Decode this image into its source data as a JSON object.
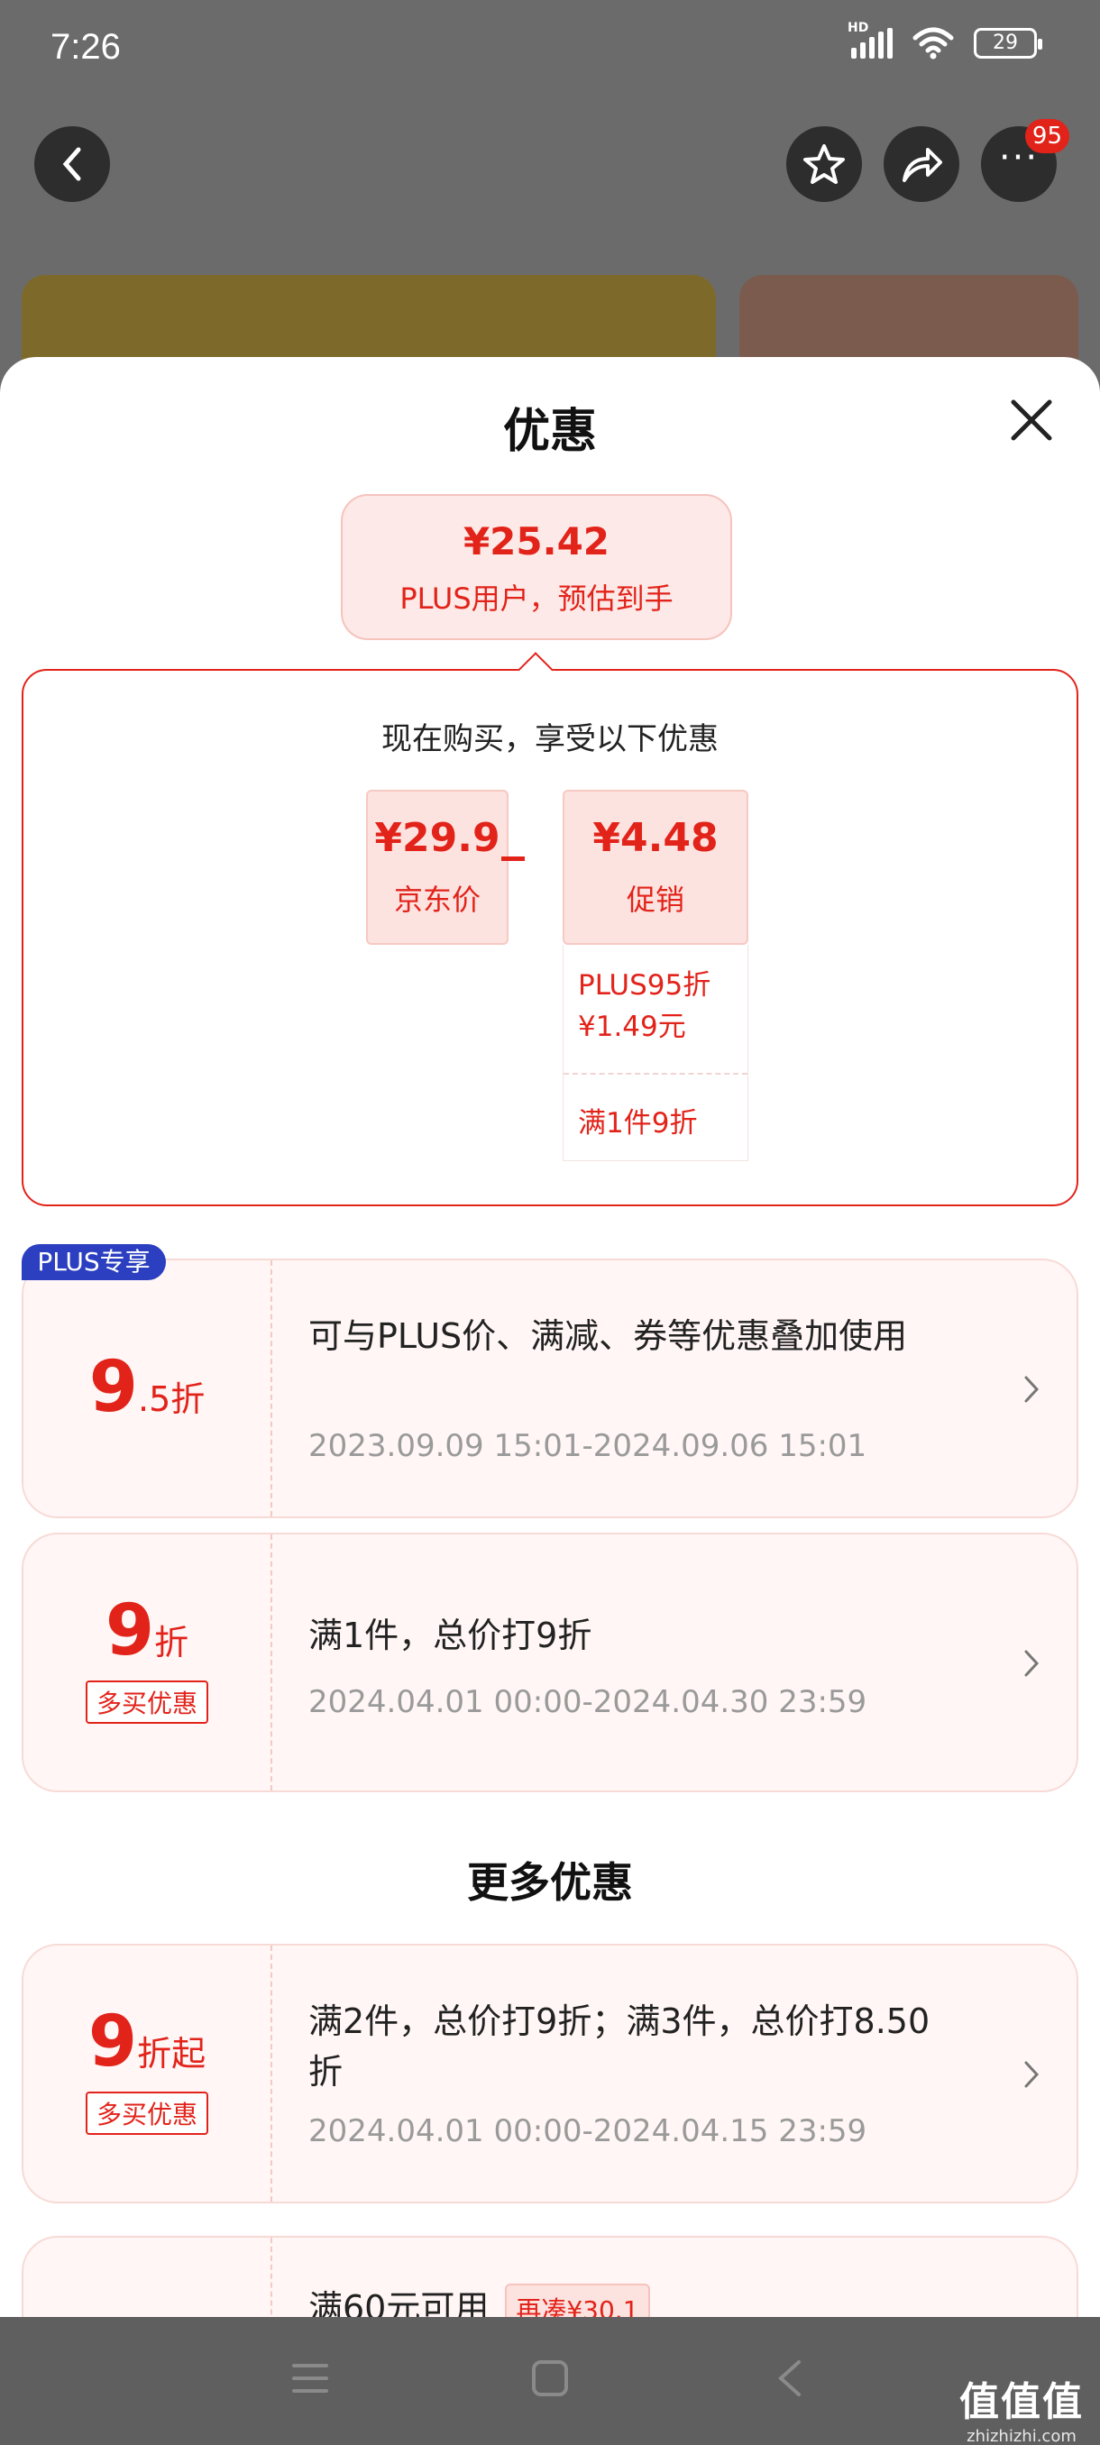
{
  "status_bar": {
    "time": "7:26",
    "network": "HD",
    "battery": "29"
  },
  "header": {
    "cart_badge": "95"
  },
  "sheet": {
    "title": "优惠",
    "estimate": {
      "price": "¥25.42",
      "note": "PLUS用户，预估到手"
    },
    "breakdown": {
      "title": "现在购买，享受以下优惠",
      "jd_price": {
        "amount": "¥29.9",
        "label": "京东价"
      },
      "promo": {
        "amount": "¥4.48",
        "label": "促销"
      },
      "promo_items": [
        "PLUS95折",
        "¥1.49元",
        "满1件9折"
      ]
    },
    "coupons": [
      {
        "badge": "PLUS专享",
        "big": "9",
        "small": ".5折",
        "desc": "可与PLUS价、满减、券等优惠叠加使用",
        "date": "2023.09.09 15:01-2024.09.06 15:01"
      },
      {
        "big": "9",
        "small": "折",
        "tag": "多买优惠",
        "desc": "满1件，总价打9折",
        "date": "2024.04.01 00:00-2024.04.30 23:59"
      }
    ],
    "more_title": "更多优惠",
    "more_coupons": [
      {
        "big": "9",
        "small": "折起",
        "tag": "多买优惠",
        "desc": "满2件，总价打9折；满3件，总价打8.50折",
        "date": "2024.04.01 00:00-2024.04.15 23:59"
      },
      {
        "desc": "满60元可用",
        "tag": "再凑¥30.1"
      }
    ]
  },
  "watermark": {
    "main": "值值值",
    "sub": "zhizhizhi.com"
  },
  "colors": {
    "accent": "#e2231a",
    "plus_blue": "#2b3fc0",
    "overlay": "#6b6b6b"
  }
}
